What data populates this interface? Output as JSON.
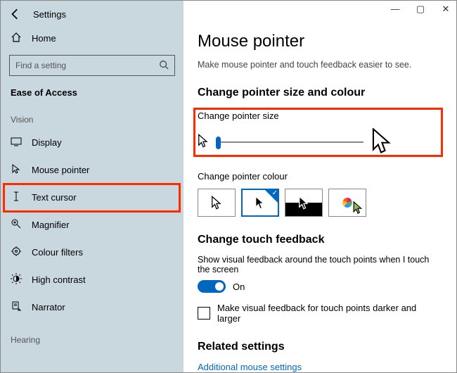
{
  "app": {
    "title": "Settings"
  },
  "window_controls": {
    "min": "—",
    "max": "▢",
    "close": "✕"
  },
  "sidebar": {
    "home": "Home",
    "search_placeholder": "Find a setting",
    "category": "Ease of Access",
    "group_vision": "Vision",
    "group_hearing": "Hearing",
    "items": [
      {
        "label": "Display"
      },
      {
        "label": "Mouse pointer"
      },
      {
        "label": "Text cursor"
      },
      {
        "label": "Magnifier"
      },
      {
        "label": "Colour filters"
      },
      {
        "label": "High contrast"
      },
      {
        "label": "Narrator"
      }
    ]
  },
  "page": {
    "title": "Mouse pointer",
    "subtitle": "Make mouse pointer and touch feedback easier to see.",
    "section_size_colour": "Change pointer size and colour",
    "size_label": "Change pointer size",
    "colour_label": "Change pointer colour",
    "section_touch": "Change touch feedback",
    "touch_text": "Show visual feedback around the touch points when I touch the screen",
    "toggle_state": "On",
    "checkbox_label": "Make visual feedback for touch points darker and larger",
    "section_related": "Related settings",
    "link_additional": "Additional mouse settings"
  }
}
